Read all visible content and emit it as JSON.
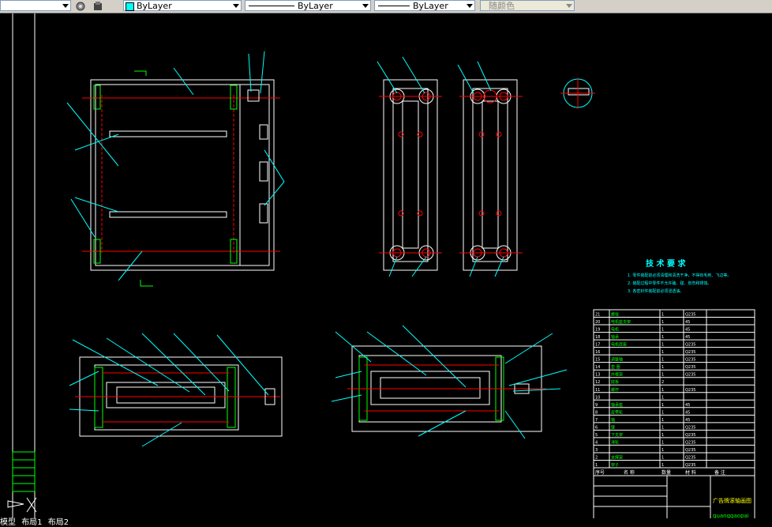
{
  "toolbar": {
    "color_label": "ByLayer",
    "linetype_label": "ByLayer",
    "lineweight_label": "ByLayer",
    "plotstyle_label": "随颜色"
  },
  "drawing": {
    "tech_title": "技 术 要 求",
    "tech_notes": [
      "1. 零件装配前必须清理和清洗干净，不得有毛刺、飞边等。",
      "2. 装配过程中零件不允许磕、碰、划伤和锈蚀。",
      "3. 各密封件装配前必须浸透油。"
    ],
    "bom_rows": [
      [
        "21",
        "螺栓",
        "1",
        "Q235"
      ],
      [
        "20",
        "电机座支架",
        "1",
        "45"
      ],
      [
        "19",
        "电机",
        "1",
        "45"
      ],
      [
        "18",
        "轴承",
        "1",
        "45"
      ],
      [
        "17",
        "电机底座",
        "1",
        "Q235"
      ],
      [
        "16",
        "",
        "1",
        "Q235"
      ],
      [
        "15",
        "调整轴",
        "1",
        "Q235"
      ],
      [
        "14",
        "垫 圈",
        "1",
        "Q235"
      ],
      [
        "13",
        "外框架",
        "1",
        "Q235"
      ],
      [
        "12",
        "底板",
        "2",
        ""
      ],
      [
        "11",
        "螺杆",
        "1",
        "Q235"
      ],
      [
        "10",
        "",
        "1",
        ""
      ],
      [
        "9",
        "轴承座",
        "1",
        "45"
      ],
      [
        "8",
        "皮带轮",
        "1",
        "45"
      ],
      [
        "7",
        "轴",
        "1",
        "45"
      ],
      [
        "6",
        "键",
        "1",
        "Q235"
      ],
      [
        "5",
        "下支架",
        "1",
        "Q235"
      ],
      [
        "4",
        "滑轮",
        "1",
        "Q235"
      ],
      [
        "3",
        "",
        "1",
        "Q235"
      ],
      [
        "2",
        "支撑架",
        "1",
        "Q235"
      ],
      [
        "1",
        "架子",
        "1",
        "Q235"
      ]
    ],
    "bom_header": [
      "序号",
      "名 称",
      "数量",
      "材 料",
      "备 注"
    ],
    "title_name": "广告牌滚轴画图",
    "title_code": "guanggaopai"
  },
  "layout_tabs": [
    "模型",
    "布局1",
    "布局2"
  ]
}
